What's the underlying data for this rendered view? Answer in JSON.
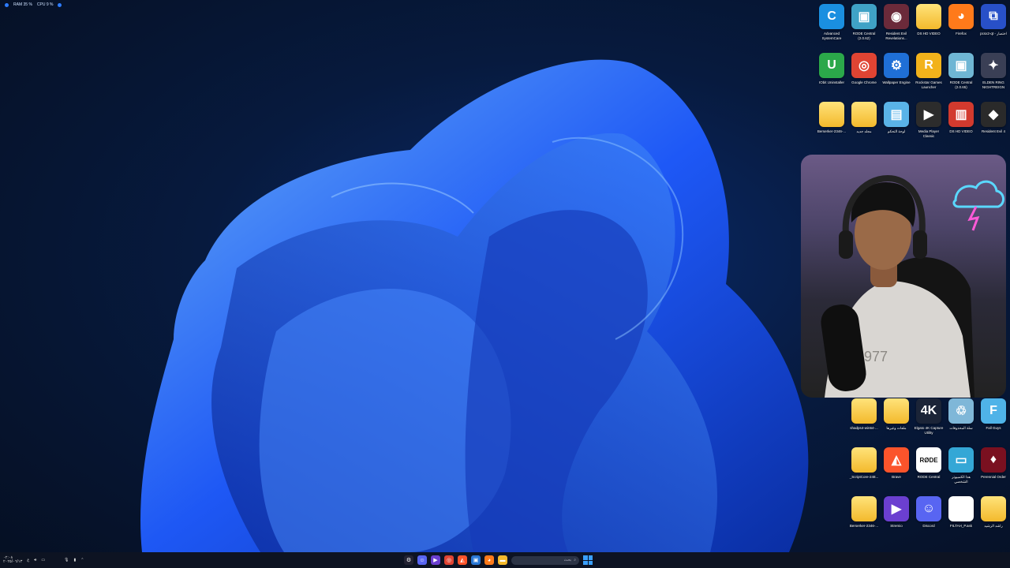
{
  "stats": {
    "ram": "RAM 35 %",
    "cpu": "CPU 9 %"
  },
  "desktop_icons": [
    {
      "label": "Advanced SystemCare",
      "glyph": "C",
      "color": "#1a8fe0"
    },
    {
      "label": "RODE Central (2.0.62)",
      "glyph": "▣",
      "color": "#3fa2c6"
    },
    {
      "label": "Resident Evil Revelations...",
      "glyph": "◉",
      "color": "#6b2a3a"
    },
    {
      "label": "DS HD VIDEO",
      "glyph": "",
      "color": "folder"
    },
    {
      "label": "Firefox",
      "glyph": "◕",
      "color": "#ff7a1a"
    },
    {
      "label": "pcsx2-qt - اختصار",
      "glyph": "⧉",
      "color": "#2850c8"
    },
    {
      "label": "IObit Uninstaller",
      "glyph": "U",
      "color": "#2ba84a"
    },
    {
      "label": "Google Chrome",
      "glyph": "◎",
      "color": "#e04433"
    },
    {
      "label": "Wallpaper Engine",
      "glyph": "⚙",
      "color": "#1f6fd6"
    },
    {
      "label": "Rockstar Games Launcher",
      "glyph": "R",
      "color": "#f2b21b"
    },
    {
      "label": "RODE Central (2.0.65)",
      "glyph": "▣",
      "color": "#6fb6d4"
    },
    {
      "label": "ELDEN RING NIGHTREIGN",
      "glyph": "✦",
      "color": "#3a3f55"
    },
    {
      "label": "Berserker-2346-...",
      "glyph": "",
      "color": "folder"
    },
    {
      "label": "مجلد جديد",
      "glyph": "",
      "color": "folder"
    },
    {
      "label": "لوحة التحكم",
      "glyph": "▤",
      "color": "#5ab3e8"
    },
    {
      "label": "Media Player Classic",
      "glyph": "▶",
      "color": "#2c2c2c"
    },
    {
      "label": "DS HD VIDEO",
      "glyph": "▥",
      "color": "#d23a2e"
    },
    {
      "label": "Resident Evil 4",
      "glyph": "◆",
      "color": "#2a2a2a"
    },
    {
      "label": "shadps4-win64-...",
      "glyph": "",
      "color": "folder"
    },
    {
      "label": "ملفات وغيرها",
      "glyph": "",
      "color": "folder"
    },
    {
      "label": "Elgato 4K Capture Utility",
      "glyph": "4K",
      "color": "#1b2437"
    },
    {
      "label": "سلة المحذوفات",
      "glyph": "♲",
      "color": "#7fb7d8"
    },
    {
      "label": "Fall Guys",
      "glyph": "F",
      "color": "#4fb3e8"
    },
    {
      "label": "_ScriptCore-248...",
      "glyph": "",
      "color": "folder"
    },
    {
      "label": "Brave",
      "glyph": "◭",
      "color": "#fb542b"
    },
    {
      "label": "RODE Central",
      "glyph": "RØDE",
      "color": "#ffffff"
    },
    {
      "label": "هذا الكمبيوتر الشخصي",
      "glyph": "▭",
      "color": "#34a7d6"
    },
    {
      "label": "Perennial Order",
      "glyph": "♦",
      "color": "#7a1020"
    },
    {
      "label": "Berserker-2346-...",
      "glyph": "",
      "color": "folder"
    },
    {
      "label": "Stremio",
      "glyph": "▶",
      "color": "#6b3fd0"
    },
    {
      "label": "Discord",
      "glyph": "☺",
      "color": "#5865f2"
    },
    {
      "label": "FILTAH_P.ask",
      "glyph": "",
      "color": "#ffffff"
    },
    {
      "label": "راشد الرشيد",
      "glyph": "",
      "color": "folder"
    }
  ],
  "taskbar": {
    "search_placeholder": "بحث",
    "clock_time": "٠٢:٠٨",
    "clock_date": "٢٠٢٥/٠٦/١٣",
    "lang": "ع"
  }
}
